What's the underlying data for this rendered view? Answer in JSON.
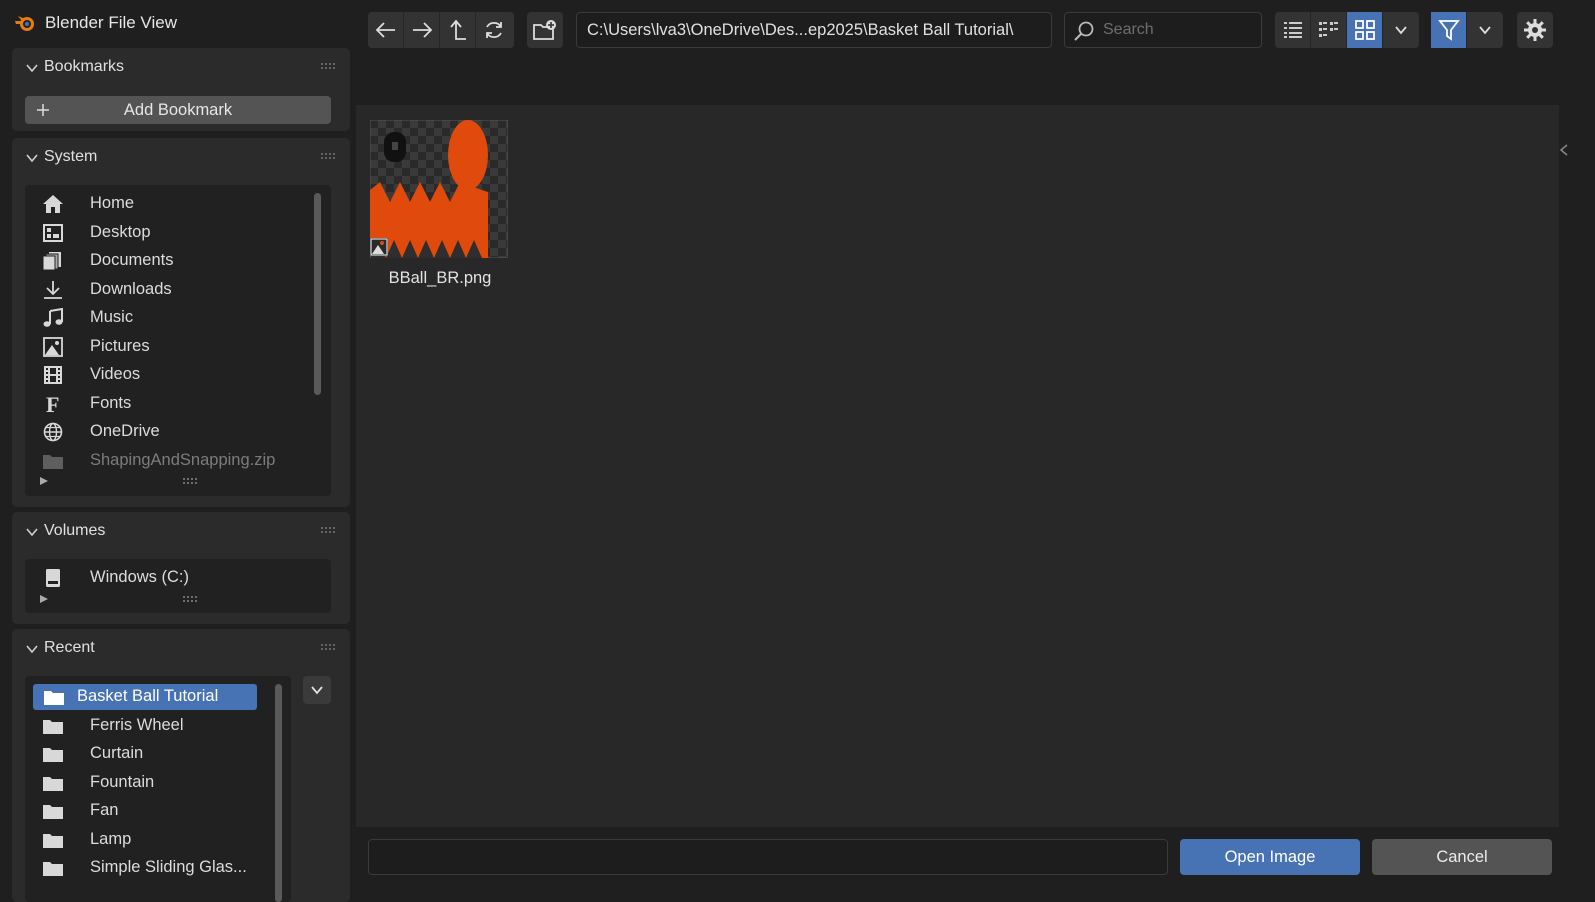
{
  "window": {
    "title": "Blender File View"
  },
  "sidebar": {
    "bookmarks": {
      "title": "Bookmarks",
      "add_label": "Add Bookmark"
    },
    "system": {
      "title": "System",
      "items": [
        {
          "label": "Home",
          "icon": "home-icon"
        },
        {
          "label": "Desktop",
          "icon": "desktop-icon"
        },
        {
          "label": "Documents",
          "icon": "documents-icon"
        },
        {
          "label": "Downloads",
          "icon": "download-icon"
        },
        {
          "label": "Music",
          "icon": "music-icon"
        },
        {
          "label": "Pictures",
          "icon": "pictures-icon"
        },
        {
          "label": "Videos",
          "icon": "videos-icon"
        },
        {
          "label": "Fonts",
          "icon": "font-icon"
        },
        {
          "label": "OneDrive",
          "icon": "globe-icon"
        },
        {
          "label": "ShapingAndSnapping.zip",
          "icon": "folder-icon"
        }
      ]
    },
    "volumes": {
      "title": "Volumes",
      "items": [
        {
          "label": "Windows (C:)",
          "icon": "drive-icon"
        }
      ]
    },
    "recent": {
      "title": "Recent",
      "items": [
        {
          "label": "Basket Ball Tutorial",
          "icon": "folder-icon",
          "active": true
        },
        {
          "label": "Ferris Wheel",
          "icon": "folder-icon"
        },
        {
          "label": "Curtain",
          "icon": "folder-icon"
        },
        {
          "label": "Fountain",
          "icon": "folder-icon"
        },
        {
          "label": "Fan",
          "icon": "folder-icon"
        },
        {
          "label": "Lamp",
          "icon": "folder-icon"
        },
        {
          "label": "Simple Sliding Glas...",
          "icon": "folder-icon"
        }
      ]
    }
  },
  "toolbar": {
    "path": "C:\\Users\\lva3\\OneDrive\\Des...ep2025\\Basket Ball Tutorial\\",
    "search_placeholder": "Search",
    "display_mode": "thumbnails"
  },
  "files": [
    {
      "name": "BBall_BR.png",
      "type": "image"
    }
  ],
  "footer": {
    "filename_value": "",
    "open_label": "Open Image",
    "cancel_label": "Cancel"
  },
  "colors": {
    "accent": "#4772b3",
    "thumbnail_orange": "#e04a0c"
  }
}
